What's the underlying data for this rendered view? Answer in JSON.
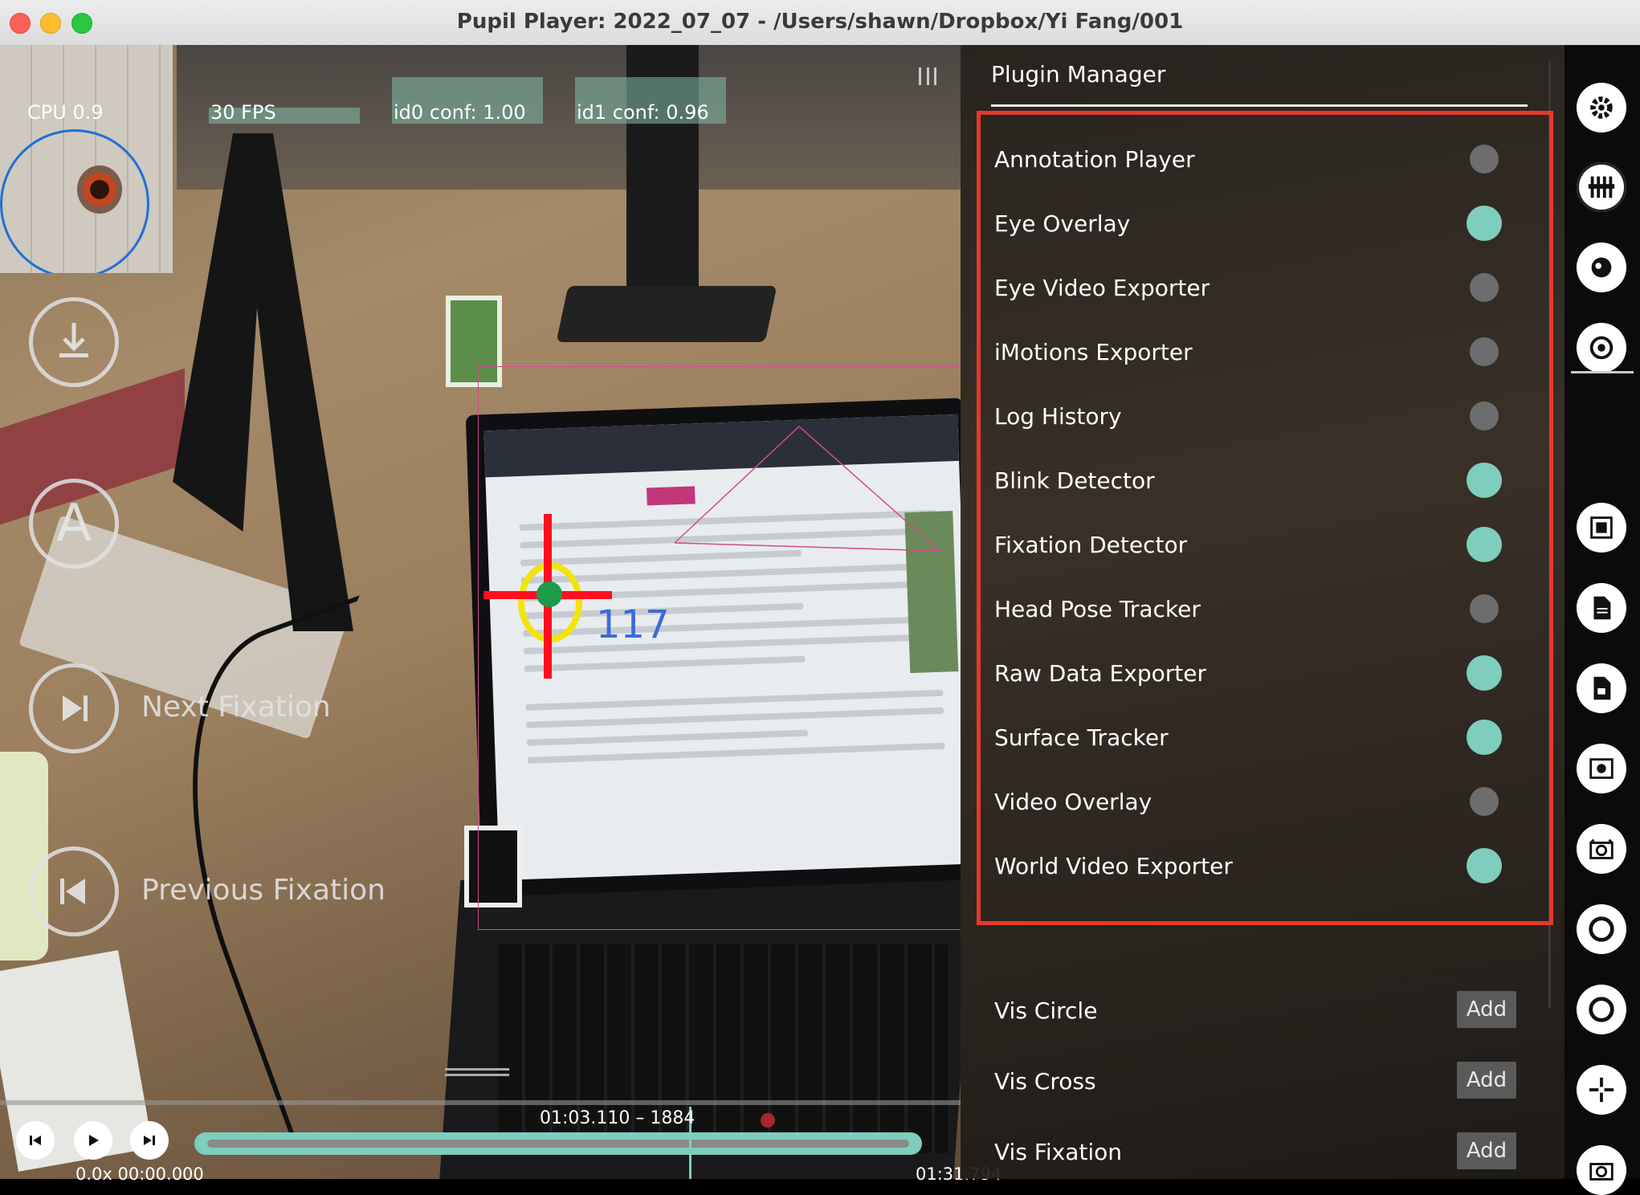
{
  "window": {
    "title": "Pupil Player: 2022_07_07 - /Users/shawn/Dropbox/Yi Fang/001"
  },
  "stats": {
    "cpu": "CPU 0.9",
    "fps": "30 FPS",
    "id0": "id0 conf: 1.00",
    "id1": "id1 conf: 0.96"
  },
  "overlay": {
    "fixation_id": "117"
  },
  "left_buttons": {
    "annotation_letter": "A",
    "next_fixation": "Next Fixation",
    "previous_fixation": "Previous Fixation"
  },
  "timeline": {
    "current": "01:03.110 – 1884",
    "start": "0.0x  00:00.000",
    "end": "01:31.794",
    "progress": 0.69
  },
  "plugin_manager": {
    "title": "Plugin Manager",
    "plugins": [
      {
        "label": "Annotation Player",
        "enabled": false
      },
      {
        "label": "Eye Overlay",
        "enabled": true
      },
      {
        "label": "Eye Video Exporter",
        "enabled": false
      },
      {
        "label": "iMotions Exporter",
        "enabled": false
      },
      {
        "label": "Log History",
        "enabled": false
      },
      {
        "label": "Blink Detector",
        "enabled": true
      },
      {
        "label": "Fixation Detector",
        "enabled": true
      },
      {
        "label": "Head Pose Tracker",
        "enabled": false
      },
      {
        "label": "Raw Data Exporter",
        "enabled": true
      },
      {
        "label": "Surface Tracker",
        "enabled": true
      },
      {
        "label": "Video Overlay",
        "enabled": false
      },
      {
        "label": "World Video Exporter",
        "enabled": true
      }
    ],
    "vis_plugins": [
      {
        "label": "Vis Circle",
        "button": "Add"
      },
      {
        "label": "Vis Cross",
        "button": "Add"
      },
      {
        "label": "Vis Fixation",
        "button": "Add"
      }
    ]
  },
  "colors": {
    "accent": "#7fcdbd",
    "highlight_border": "#e5392a",
    "gaze_cross": "#ff0f1f",
    "gaze_ring": "#f3e30d"
  },
  "icons": [
    "gear-icon",
    "plugin-manager-icon",
    "eye-icon",
    "pupil-icon",
    "surface-icon",
    "file-icon",
    "export-icon",
    "eye-video-icon",
    "camera-icon",
    "circle-icon",
    "circle-icon",
    "crosshair-icon",
    "camera-icon"
  ]
}
